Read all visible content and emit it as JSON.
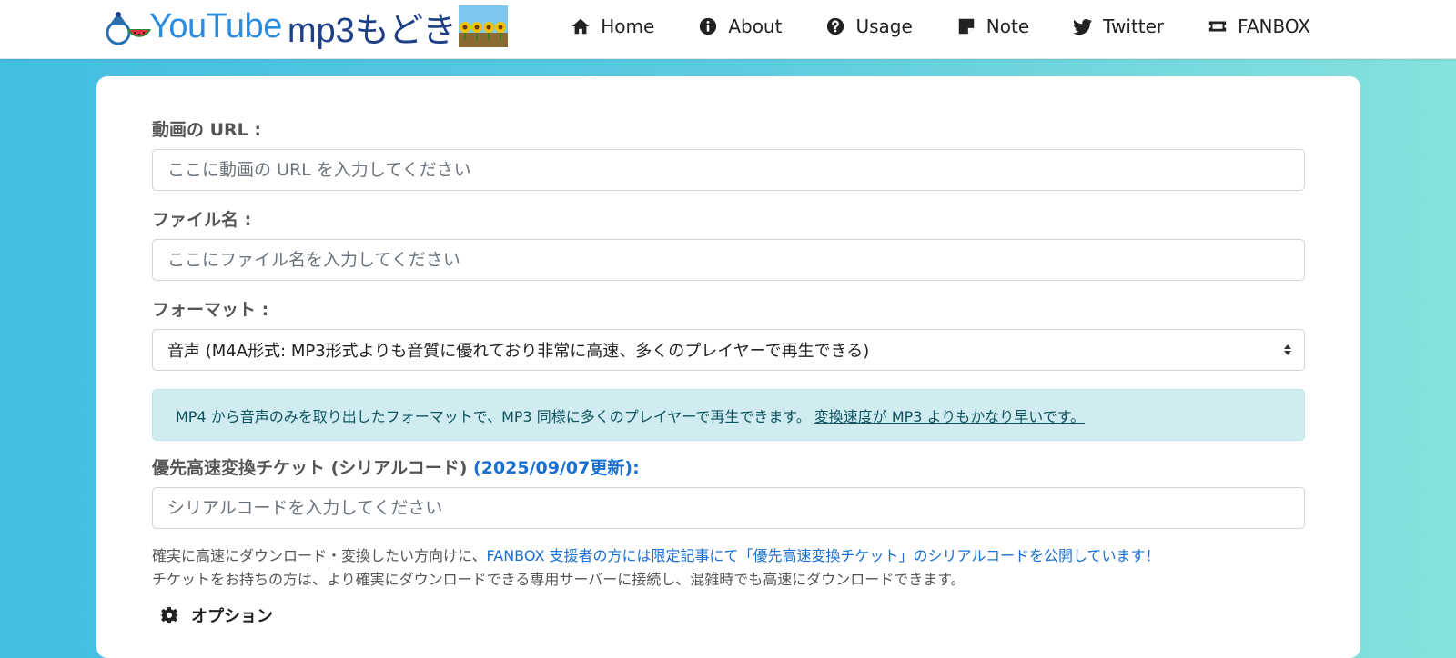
{
  "brand": {
    "youtube_text": "YouTube",
    "mp3_text": "mp3もどき"
  },
  "nav": {
    "items": [
      {
        "label": "Home",
        "icon": "home-icon"
      },
      {
        "label": "About",
        "icon": "info-circle-icon"
      },
      {
        "label": "Usage",
        "icon": "question-circle-icon"
      },
      {
        "label": "Note",
        "icon": "note-icon"
      },
      {
        "label": "Twitter",
        "icon": "twitter-icon"
      },
      {
        "label": "FANBOX",
        "icon": "ticket-icon"
      }
    ]
  },
  "form": {
    "url_label": "動画の URL :",
    "url_placeholder": "ここに動画の URL を入力してください",
    "filename_label": "ファイル名 :",
    "filename_placeholder": "ここにファイル名を入力してください",
    "format_label": "フォーマット :",
    "format_selected": "音声 (M4A形式: MP3形式よりも音質に優れており非常に高速、多くのプレイヤーで再生できる)",
    "format_info_text": "MP4 から音声のみを取り出したフォーマットで、MP3 同様に多くのプレイヤーで再生できます。",
    "format_info_emphasis": "変換速度が MP3 よりもかなり早いです。",
    "ticket_label": "優先高速変換チケット (シリアルコード)",
    "ticket_update": "(2025/09/07更新)",
    "ticket_label_suffix": ":",
    "ticket_placeholder": "シリアルコードを入力してください",
    "ticket_help_line1_prefix": "確実に高速にダウンロード・変換したい方向けに、",
    "ticket_help_line1_link": "FANBOX 支援者の方には限定記事にて「優先高速変換チケット」のシリアルコードを公開しています！",
    "ticket_help_line2": "チケットをお持ちの方は、より確実にダウンロードできる専用サーバーに接続し、混雑時でも高速にダウンロードできます。",
    "options_label": "オプション"
  },
  "colors": {
    "link_blue": "#1a6fd2",
    "info_bg": "#d1ecf1",
    "info_text": "#0c5460",
    "brand_blue": "#2a8de0",
    "brand_navy": "#1d3f86"
  }
}
